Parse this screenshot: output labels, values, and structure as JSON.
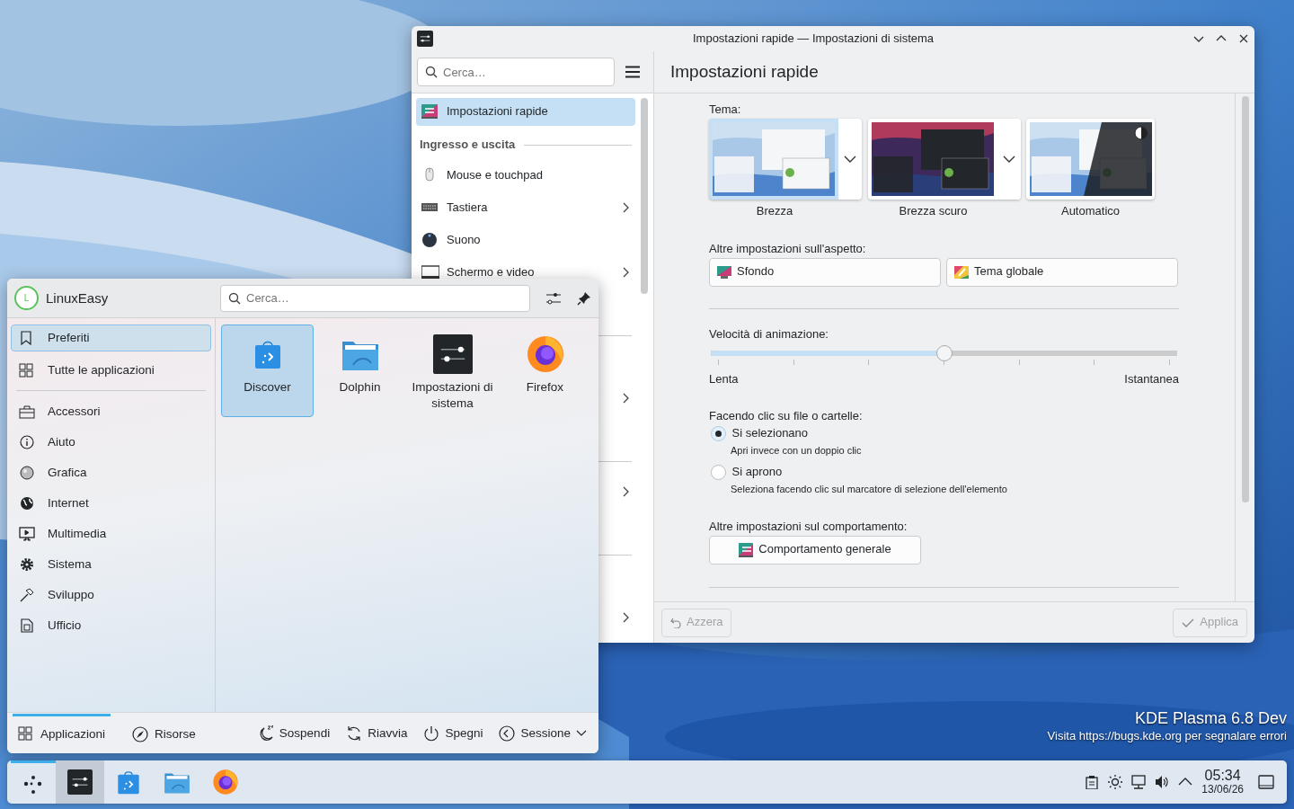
{
  "settings_window": {
    "title": "Impostazioni rapide — Impostazioni di sistema",
    "search": {
      "placeholder": "Cerca…"
    },
    "sidebar": {
      "items": [
        {
          "kind": "item",
          "label": "Impostazioni rapide",
          "selected": true,
          "expandable": false
        },
        {
          "kind": "header",
          "label": "Ingresso e uscita"
        },
        {
          "kind": "item",
          "label": "Mouse e touchpad",
          "selected": false,
          "expandable": false
        },
        {
          "kind": "item",
          "label": "Tastiera",
          "selected": false,
          "expandable": true
        },
        {
          "kind": "item",
          "label": "Suono",
          "selected": false,
          "expandable": false
        },
        {
          "kind": "item",
          "label": "Schermo e video",
          "selected": false,
          "expandable": true
        },
        {
          "kind": "item"
        },
        {
          "kind": "header"
        },
        {
          "kind": "item"
        },
        {
          "kind": "item",
          "selected": false,
          "expandable": true
        },
        {
          "kind": "item"
        },
        {
          "kind": "header"
        },
        {
          "kind": "item",
          "selected": false,
          "expandable": true
        },
        {
          "kind": "item"
        },
        {
          "kind": "header"
        },
        {
          "kind": "item"
        },
        {
          "kind": "item",
          "selected": false,
          "expandable": true
        }
      ]
    },
    "page": {
      "heading": "Impostazioni rapide",
      "theme": {
        "label": "Tema:",
        "options": [
          {
            "name": "Brezza",
            "kind": "light",
            "selected": true,
            "has_variants": true
          },
          {
            "name": "Brezza scuro",
            "kind": "dark",
            "selected": false,
            "has_variants": true
          },
          {
            "name": "Automatico",
            "kind": "auto",
            "selected": false,
            "has_variants": false
          }
        ]
      },
      "appearance": {
        "label": "Altre impostazioni sull'aspetto:",
        "buttons": [
          "Sfondo",
          "Tema globale"
        ]
      },
      "animation": {
        "label": "Velocità di animazione:",
        "level": 0.5,
        "min_label": "Lenta",
        "max_label": "Istantanea"
      },
      "click": {
        "label": "Facendo clic su file o cartelle:",
        "options": [
          {
            "label": "Si selezionano",
            "hint": "Apri invece con un doppio clic",
            "selected": true
          },
          {
            "label": "Si aprono",
            "hint": "Seleziona facendo clic sul marcatore di selezione dell'elemento",
            "selected": false
          }
        ]
      },
      "behavior": {
        "label": "Altre impostazioni sul comportamento:",
        "button": "Comportamento generale"
      }
    },
    "footer": {
      "reset": {
        "label": "Azzera",
        "disabled": true
      },
      "apply": {
        "label": "Applica",
        "disabled": true
      }
    }
  },
  "launcher": {
    "user": {
      "initial": "L",
      "name": "LinuxEasy"
    },
    "search": {
      "placeholder": "Cerca…"
    },
    "views": [
      {
        "label": "Preferiti",
        "selected": true
      },
      {
        "label": "Tutte le applicazioni",
        "selected": false
      }
    ],
    "categories": [
      {
        "label": "Accessori",
        "selected": false
      },
      {
        "label": "Aiuto",
        "selected": false
      },
      {
        "label": "Grafica",
        "selected": false
      },
      {
        "label": "Internet",
        "selected": false
      },
      {
        "label": "Multimedia",
        "selected": false
      },
      {
        "label": "Sistema",
        "selected": false
      },
      {
        "label": "Sviluppo",
        "selected": false
      },
      {
        "label": "Ufficio",
        "selected": false
      }
    ],
    "apps": [
      {
        "name": "Discover",
        "selected": true
      },
      {
        "name": "Dolphin",
        "selected": false
      },
      {
        "name": "Impostazioni di sistema",
        "selected": false
      },
      {
        "name": "Firefox",
        "selected": false
      }
    ],
    "tabs": [
      {
        "label": "Applicazioni",
        "selected": true
      },
      {
        "label": "Risorse",
        "selected": false
      }
    ],
    "actions": [
      "Sospendi",
      "Riavvia",
      "Spegni",
      "Sessione"
    ]
  },
  "desktop_notice": {
    "title": "KDE Plasma 6.8 Dev",
    "subtitle": "Visita https://bugs.kde.org per segnalare errori"
  },
  "taskbar": {
    "launcher_open": true,
    "tasks": [
      {
        "active": true
      },
      {
        "active": false
      },
      {
        "active": false
      },
      {
        "active": false
      }
    ],
    "clock": {
      "time": "05:34",
      "date": "13/06/26"
    }
  }
}
